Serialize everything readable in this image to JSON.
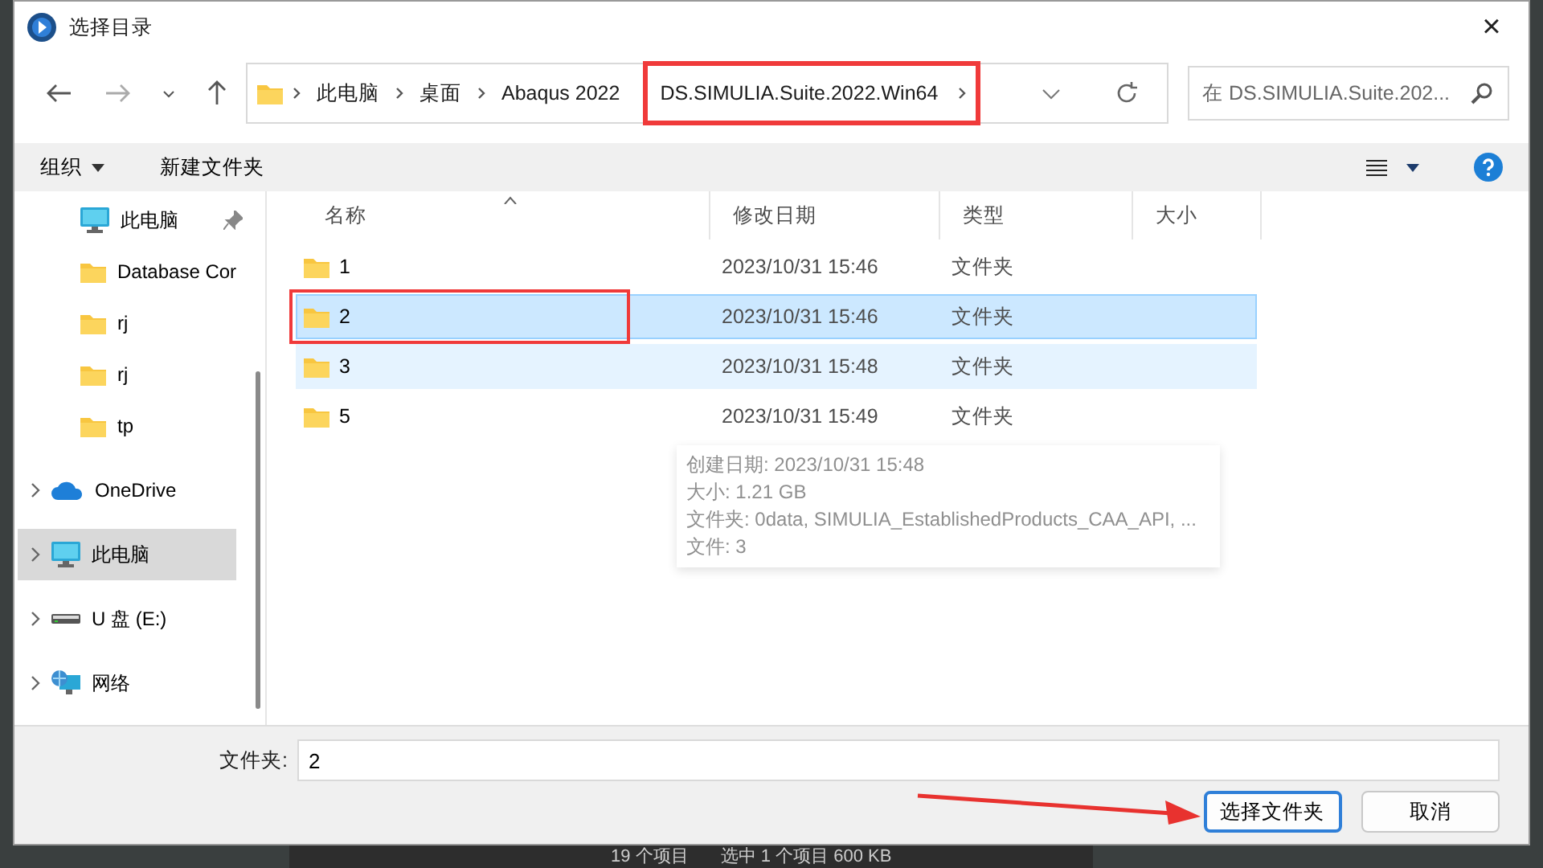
{
  "window": {
    "title": "选择目录",
    "close": "×"
  },
  "nav": {
    "breadcrumbs": [
      {
        "label": "此电脑",
        "highlighted": false
      },
      {
        "label": "桌面",
        "highlighted": false
      },
      {
        "label": "Abaqus 2022",
        "highlighted": false
      },
      {
        "label": "DS.SIMULIA.Suite.2022.Win64",
        "highlighted": true
      }
    ],
    "search": {
      "placeholder": "在 DS.SIMULIA.Suite.202..."
    }
  },
  "toolbar": {
    "organize": "组织",
    "new_folder": "新建文件夹"
  },
  "sidebar": {
    "items": [
      {
        "label": "此电脑",
        "kind": "pc",
        "expander": false,
        "pinned": true,
        "selected": false
      },
      {
        "label": "Database Cor",
        "kind": "folder",
        "expander": false,
        "pinned": false,
        "selected": false
      },
      {
        "label": "rj",
        "kind": "folder",
        "expander": false,
        "pinned": false,
        "selected": false
      },
      {
        "label": "rj",
        "kind": "folder",
        "expander": false,
        "pinned": false,
        "selected": false
      },
      {
        "label": "tp",
        "kind": "folder",
        "expander": false,
        "pinned": false,
        "selected": false
      },
      {
        "label": "OneDrive",
        "kind": "cloud",
        "expander": true,
        "pinned": false,
        "selected": false
      },
      {
        "label": "此电脑",
        "kind": "pc",
        "expander": true,
        "pinned": false,
        "selected": true
      },
      {
        "label": "U 盘 (E:)",
        "kind": "drive",
        "expander": true,
        "pinned": false,
        "selected": false
      },
      {
        "label": "网络",
        "kind": "network",
        "expander": true,
        "pinned": false,
        "selected": false
      }
    ]
  },
  "table": {
    "columns": [
      "名称",
      "修改日期",
      "类型",
      "大小"
    ],
    "rows": [
      {
        "name": "1",
        "modified": "2023/10/31 15:46",
        "type": "文件夹",
        "selected": false,
        "hovered": false,
        "highlighted": false
      },
      {
        "name": "2",
        "modified": "2023/10/31 15:46",
        "type": "文件夹",
        "selected": true,
        "hovered": false,
        "highlighted": true
      },
      {
        "name": "3",
        "modified": "2023/10/31 15:48",
        "type": "文件夹",
        "selected": false,
        "hovered": true,
        "highlighted": false
      },
      {
        "name": "5",
        "modified": "2023/10/31 15:49",
        "type": "文件夹",
        "selected": false,
        "hovered": false,
        "highlighted": false
      }
    ]
  },
  "tooltip": [
    "创建日期: 2023/10/31 15:48",
    "大小: 1.21 GB",
    "文件夹: 0data, SIMULIA_EstablishedProducts_CAA_API, ...",
    "文件: 3"
  ],
  "footer": {
    "folder_label": "文件夹:",
    "folder_value": "2",
    "buttons": [
      {
        "label": "选择文件夹",
        "primary": true
      },
      {
        "label": "取消",
        "primary": false
      }
    ]
  },
  "background_status": [
    "19 个项目",
    "选中 1 个项目  600 KB"
  ]
}
